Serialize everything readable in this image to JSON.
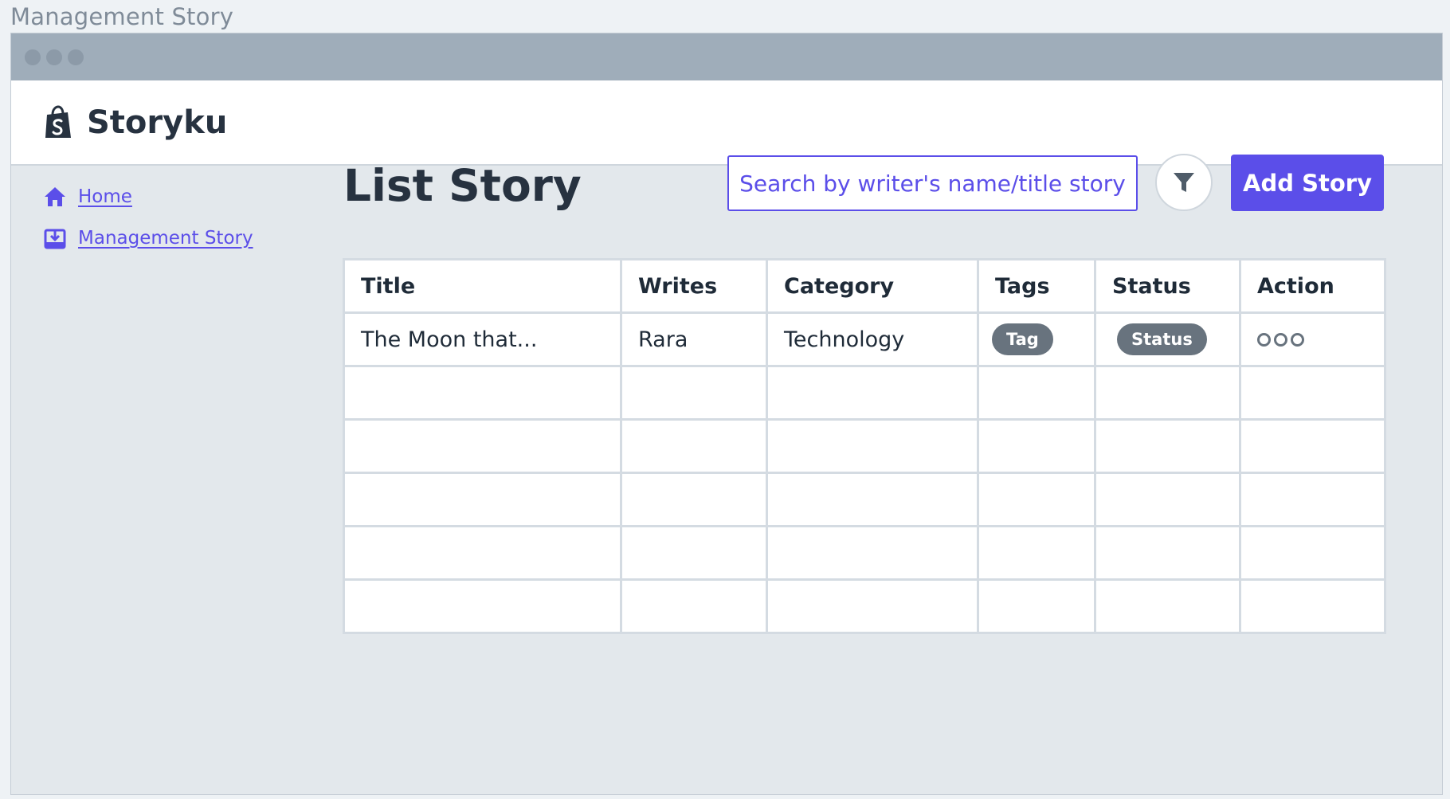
{
  "frame_title": "Management Story",
  "app": {
    "brand": "Storyku",
    "logo_icon": "shopping-bag-logo-icon"
  },
  "sidebar": {
    "items": [
      {
        "label": "Home",
        "icon": "home-icon"
      },
      {
        "label": "Management Story",
        "icon": "download-box-icon"
      }
    ]
  },
  "main": {
    "title": "List Story",
    "search": {
      "placeholder": "Search by writer's name/title story",
      "value": ""
    },
    "filter_icon": "filter-icon",
    "add_button": "Add Story"
  },
  "table": {
    "columns": [
      "Title",
      "Writes",
      "Category",
      "Tags",
      "Status",
      "Action"
    ],
    "rows": [
      {
        "title": "The Moon that...",
        "writer": "Rara",
        "category": "Technology",
        "tag": "Tag",
        "status": "Status",
        "action_icon": "more-options-icon"
      }
    ],
    "empty_rows": 5
  },
  "colors": {
    "accent": "#5b4ee9",
    "titlebar": "#9fadba",
    "page_bg": "#e3e8ec",
    "pill": "#68737e",
    "text": "#273240"
  }
}
